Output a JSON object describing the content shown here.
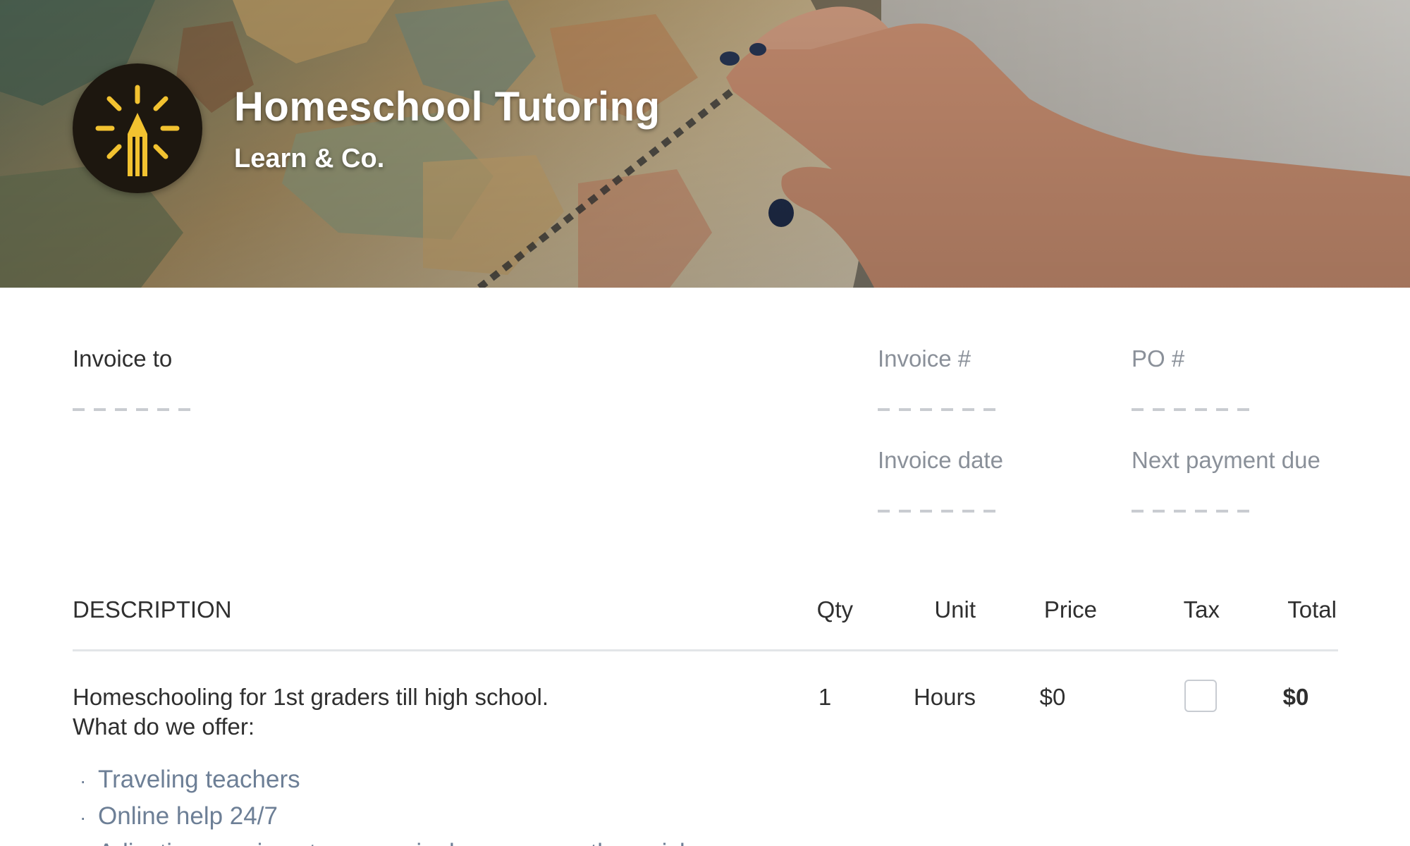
{
  "header": {
    "title": "Homeschool Tutoring",
    "subtitle": "Learn & Co.",
    "logo_icon": "pencil-lightbulb-icon",
    "logo_color": "#f2c230",
    "logo_bg": "#1d170f"
  },
  "invoice": {
    "invoice_to_label": "Invoice to",
    "invoice_number_label": "Invoice #",
    "po_number_label": "PO #",
    "invoice_date_label": "Invoice date",
    "next_payment_label": "Next payment due"
  },
  "table": {
    "headers": {
      "description": "DESCRIPTION",
      "qty": "Qty",
      "unit": "Unit",
      "price": "Price",
      "tax": "Tax",
      "total": "Total"
    },
    "rows": [
      {
        "description_line1": "Homeschooling for 1st graders till high school.",
        "description_line2": "What do we offer:",
        "bullets": [
          "Traveling teachers",
          "Online help 24/7",
          "Adjusting sessions to every single person as they wish"
        ],
        "qty": "1",
        "unit": "Hours",
        "price": "$0",
        "tax_checked": false,
        "total": "$0"
      }
    ]
  }
}
